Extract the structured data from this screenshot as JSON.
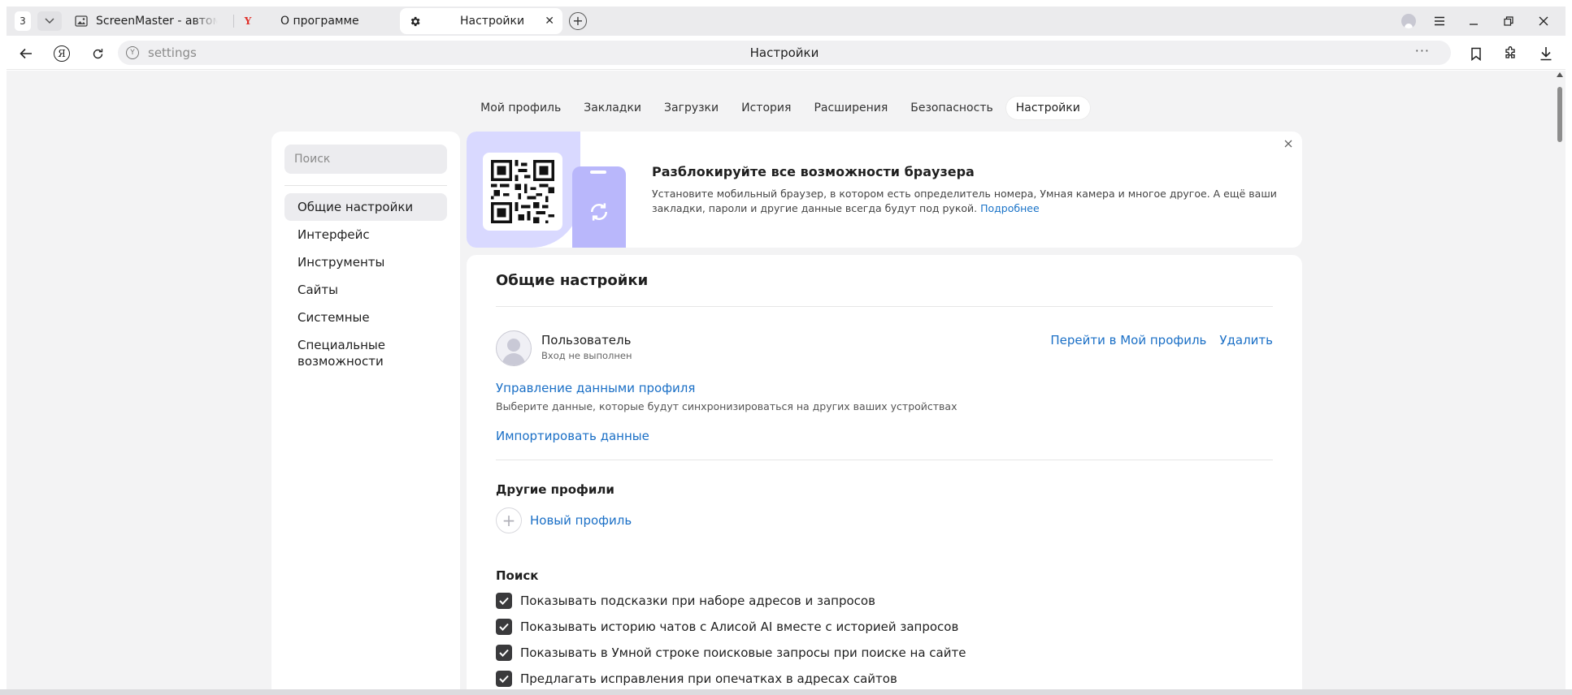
{
  "tabbar": {
    "tab_count": "3",
    "tabs": [
      {
        "title": "ScreenMaster - автоматизация"
      },
      {
        "title": "О программе",
        "favicon_letter": "Y"
      },
      {
        "title": "Настройки"
      }
    ],
    "close_glyph": "✕",
    "new_tab_glyph": "+"
  },
  "addressbar": {
    "url": "settings",
    "page_title": "Настройки",
    "more_glyph": "···"
  },
  "topnav": {
    "items": [
      "Мой профиль",
      "Закладки",
      "Загрузки",
      "История",
      "Расширения",
      "Безопасность",
      "Настройки"
    ],
    "active_index": 6
  },
  "sidebar": {
    "search_placeholder": "Поиск",
    "items": [
      "Общие настройки",
      "Интерфейс",
      "Инструменты",
      "Сайты",
      "Системные",
      "Специальные возможности"
    ],
    "active_index": 0
  },
  "banner": {
    "title": "Разблокируйте все возможности браузера",
    "text": "Установите мобильный браузер, в котором есть определитель номера, Умная камера и многое другое. А ещё ваши закладки, пароли и другие данные всегда будут под рукой.",
    "link": "Подробнее"
  },
  "general": {
    "title": "Общие настройки",
    "user_name": "Пользователь",
    "user_status": "Вход не выполнен",
    "go_to_profile": "Перейти в Мой профиль",
    "delete": "Удалить",
    "manage_data": "Управление данными профиля",
    "manage_desc": "Выберите данные, которые будут синхронизироваться на других ваших устройствах",
    "import_data": "Импортировать данные"
  },
  "other_profiles": {
    "title": "Другие профили",
    "new_profile": "Новый профиль"
  },
  "search": {
    "title": "Поиск",
    "options": [
      {
        "label": "Показывать подсказки при наборе адресов и запросов",
        "checked": true
      },
      {
        "label": "Показывать историю чатов с Алисой AI вместе с историей запросов",
        "checked": true
      },
      {
        "label": "Показывать в Умной строке поисковые запросы при поиске на сайте",
        "checked": true
      },
      {
        "label": "Предлагать исправления при опечатках в адресах сайтов",
        "checked": true
      }
    ]
  },
  "colors": {
    "link": "#1a6fc6",
    "page_bg": "#f3f3f4",
    "banner_art": "#d9d9ff",
    "checkbox": "#3a3a3c"
  },
  "icons": {
    "back": "arrow-left-icon",
    "yandex": "yandex-logo-icon",
    "reload": "reload-icon",
    "bookmark": "bookmark-icon",
    "extensions": "puzzle-icon",
    "downloads": "download-icon",
    "menu": "hamburger-icon",
    "settings_tab": "gear-icon"
  }
}
